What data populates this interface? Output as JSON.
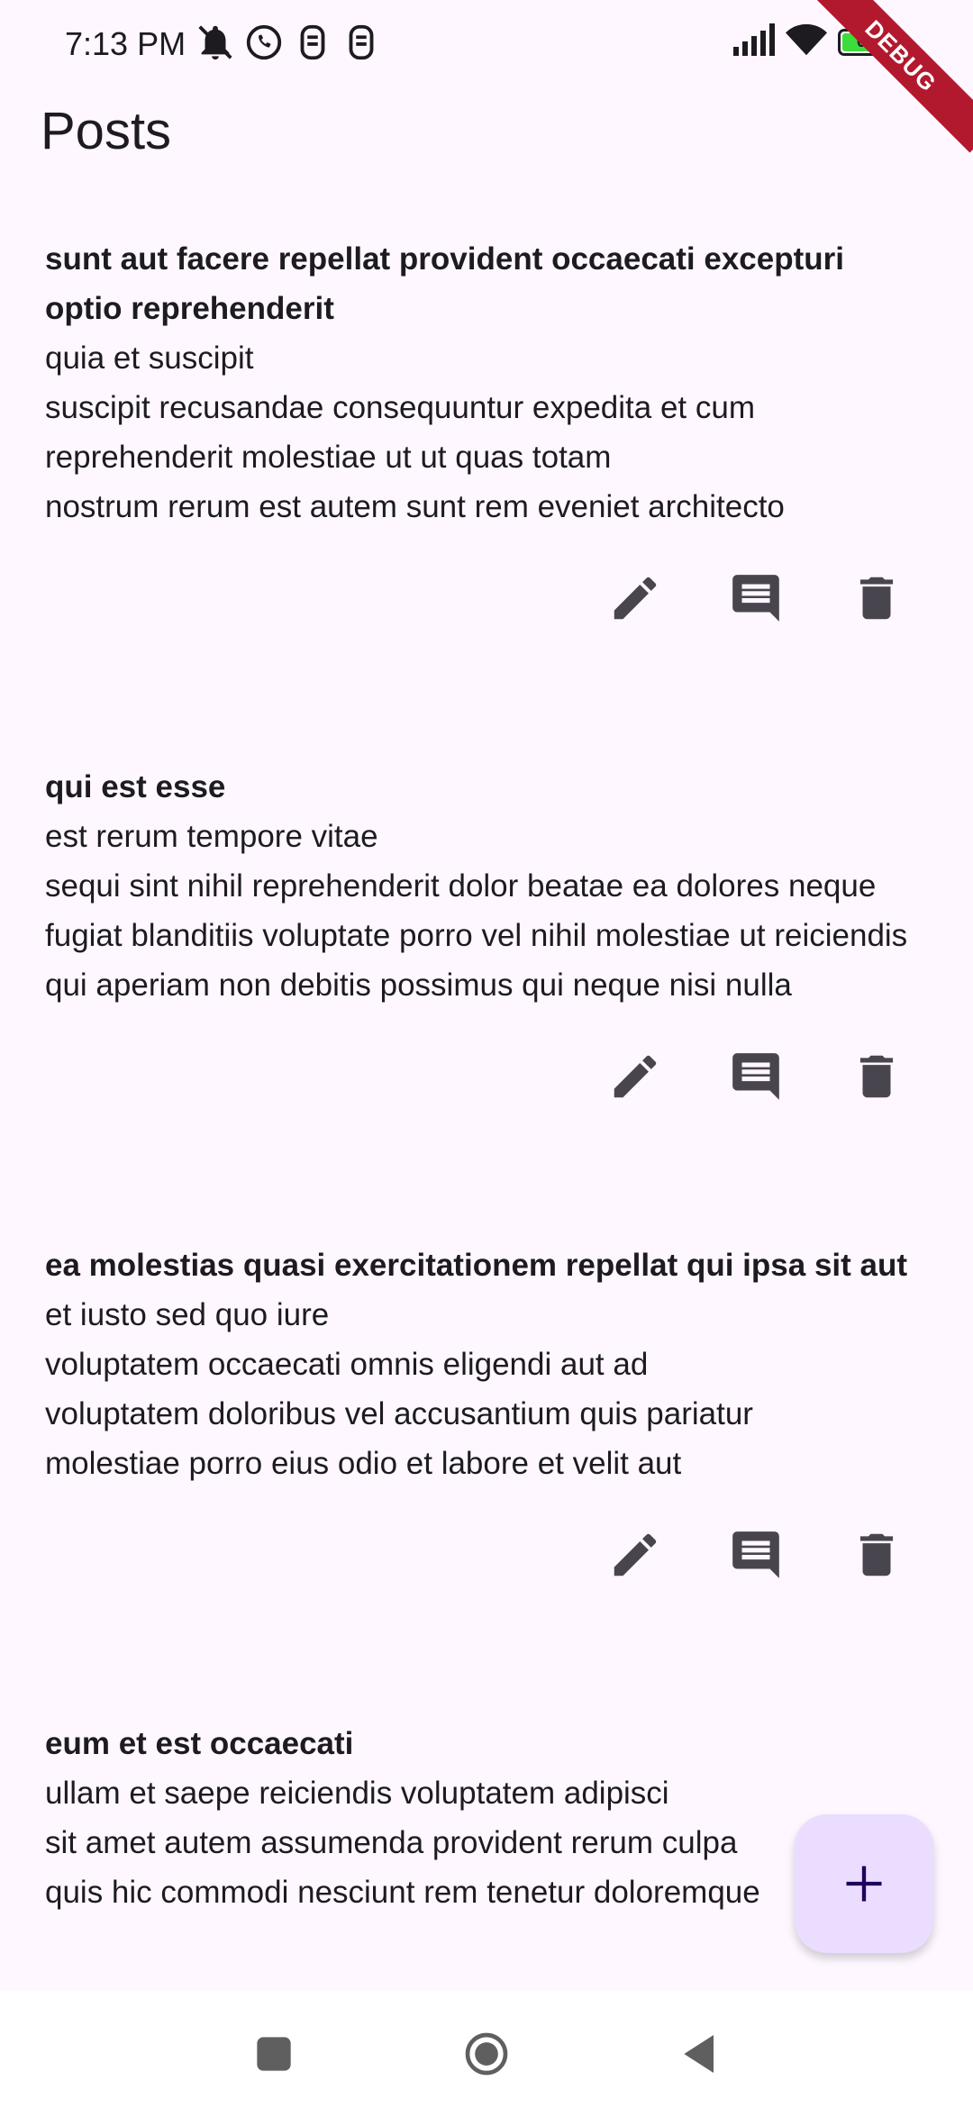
{
  "status_bar": {
    "time": "7:13 PM",
    "battery_level": "60",
    "battery_fraction": 0.6,
    "icons_left": [
      "bell-off-icon",
      "whatsapp-icon",
      "notification-app-icon",
      "notification-app-icon"
    ],
    "icons_right": [
      "signal-icon",
      "wifi-icon",
      "battery-icon"
    ]
  },
  "debug_banner": "DEBUG",
  "app_bar": {
    "title": "Posts"
  },
  "posts": [
    {
      "title": "sunt aut facere repellat provident occaecati excepturi optio reprehenderit",
      "body": "quia et suscipit\nsuscipit recusandae consequuntur expedita et cum\nreprehenderit molestiae ut ut quas totam\nnostrum rerum est autem sunt rem eveniet architecto"
    },
    {
      "title": "qui est esse",
      "body": "est rerum tempore vitae\nsequi sint nihil reprehenderit dolor beatae ea dolores neque\nfugiat blanditiis voluptate porro vel nihil molestiae ut reiciendis\nqui aperiam non debitis possimus qui neque nisi nulla"
    },
    {
      "title": "ea molestias quasi exercitationem repellat qui ipsa sit aut",
      "body": "et iusto sed quo iure\nvoluptatem occaecati omnis eligendi aut ad\nvoluptatem doloribus vel accusantium quis pariatur\nmolestiae porro eius odio et labore et velit aut"
    },
    {
      "title": "eum et est occaecati",
      "body": "ullam et saepe reiciendis voluptatem adipisci\nsit amet autem assumenda provident rerum culpa\nquis hic commodi nesciunt rem tenetur doloremque"
    }
  ],
  "actions": [
    "edit-icon",
    "comment-icon",
    "delete-icon"
  ],
  "fab": {
    "icon": "add-icon"
  },
  "nav_bar": {
    "buttons": [
      "recents-square-icon",
      "home-circle-icon",
      "back-triangle-icon"
    ]
  },
  "colors": {
    "background": "#FEF7FF",
    "icon": "#49454F",
    "fab_bg": "#EADDFF",
    "fab_icon": "#21005D",
    "debug_ribbon": "#B3192E"
  }
}
